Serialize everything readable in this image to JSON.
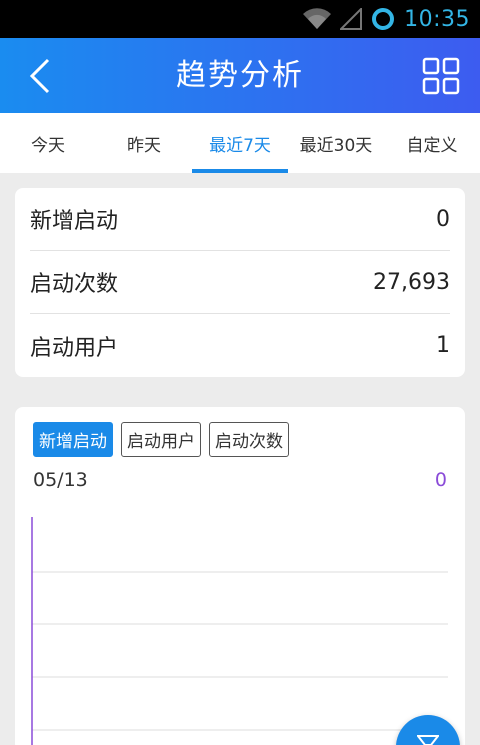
{
  "status_bar": {
    "time": "10:35",
    "icons": [
      "wifi-icon",
      "signal-icon",
      "sync-icon"
    ]
  },
  "header": {
    "title": "趋势分析",
    "back_icon": "chevron-left-icon",
    "menu_icon": "grid-icon"
  },
  "tabs": [
    {
      "label": "今天",
      "active": false
    },
    {
      "label": "昨天",
      "active": false
    },
    {
      "label": "最近7天",
      "active": true
    },
    {
      "label": "最近30天",
      "active": false
    },
    {
      "label": "自定义",
      "active": false
    }
  ],
  "summary": [
    {
      "label": "新增启动",
      "value": "0"
    },
    {
      "label": "启动次数",
      "value": "27,693"
    },
    {
      "label": "启动用户",
      "value": "1"
    }
  ],
  "chart": {
    "chips": [
      {
        "label": "新增启动",
        "active": true
      },
      {
        "label": "启动用户",
        "active": false
      },
      {
        "label": "启动次数",
        "active": false
      }
    ],
    "selected_date": "05/13",
    "selected_value": "0",
    "line_color": "#8a4bd8",
    "accent_color": "#1a8ae8"
  },
  "fab": {
    "icon": "filter-icon"
  }
}
